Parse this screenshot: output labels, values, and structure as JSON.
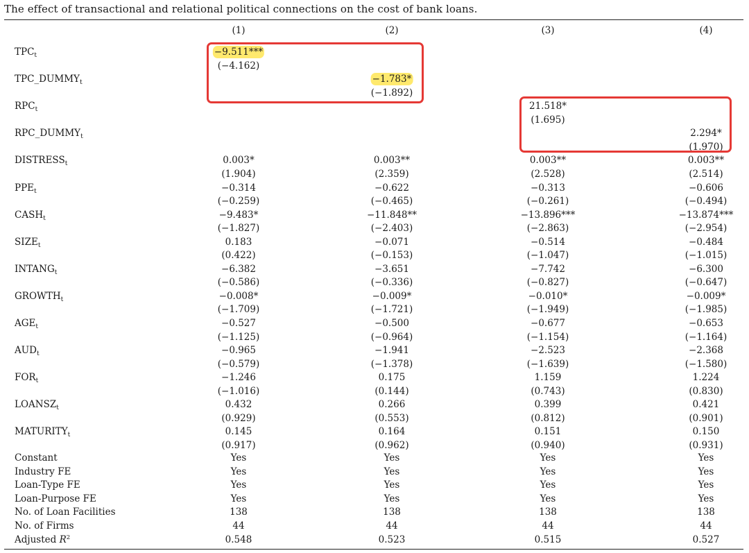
{
  "title": "The effect of transactional and relational political connections on the cost of bank loans.",
  "columns": [
    "(1)",
    "(2)",
    "(3)",
    "(4)"
  ],
  "rows": [
    {
      "name": "TPC",
      "sub": "t",
      "coef": [
        "−9.511***",
        "",
        "",
        ""
      ],
      "t": [
        "(−4.162)",
        "",
        "",
        ""
      ]
    },
    {
      "name": "TPC_DUMMY",
      "sub": "t",
      "coef": [
        "",
        "−1.783*",
        "",
        ""
      ],
      "t": [
        "",
        "(−1.892)",
        "",
        ""
      ]
    },
    {
      "name": "RPC",
      "sub": "t",
      "coef": [
        "",
        "",
        "21.518*",
        ""
      ],
      "t": [
        "",
        "",
        "(1.695)",
        ""
      ]
    },
    {
      "name": "RPC_DUMMY",
      "sub": "t",
      "coef": [
        "",
        "",
        "",
        "2.294*"
      ],
      "t": [
        "",
        "",
        "",
        "(1.970)"
      ]
    },
    {
      "name": "DISTRESS",
      "sub": "t",
      "coef": [
        "0.003*",
        "0.003**",
        "0.003**",
        "0.003**"
      ],
      "t": [
        "(1.904)",
        "(2.359)",
        "(2.528)",
        "(2.514)"
      ]
    },
    {
      "name": "PPE",
      "sub": "t",
      "coef": [
        "−0.314",
        "−0.622",
        "−0.313",
        "−0.606"
      ],
      "t": [
        "(−0.259)",
        "(−0.465)",
        "(−0.261)",
        "(−0.494)"
      ]
    },
    {
      "name": "CASH",
      "sub": "t",
      "coef": [
        "−9.483*",
        "−11.848**",
        "−13.896***",
        "−13.874***"
      ],
      "t": [
        "(−1.827)",
        "(−2.403)",
        "(−2.863)",
        "(−2.954)"
      ]
    },
    {
      "name": "SIZE",
      "sub": "t",
      "coef": [
        "0.183",
        "−0.071",
        "−0.514",
        "−0.484"
      ],
      "t": [
        "(0.422)",
        "(−0.153)",
        "(−1.047)",
        "(−1.015)"
      ]
    },
    {
      "name": "INTANG",
      "sub": "t",
      "coef": [
        "−6.382",
        "−3.651",
        "−7.742",
        "−6.300"
      ],
      "t": [
        "(−0.586)",
        "(−0.336)",
        "(−0.827)",
        "(−0.647)"
      ]
    },
    {
      "name": "GROWTH",
      "sub": "t",
      "coef": [
        "−0.008*",
        "−0.009*",
        "−0.010*",
        "−0.009*"
      ],
      "t": [
        "(−1.709)",
        "(−1.721)",
        "(−1.949)",
        "(−1.985)"
      ]
    },
    {
      "name": "AGE",
      "sub": "t",
      "coef": [
        "−0.527",
        "−0.500",
        "−0.677",
        "−0.653"
      ],
      "t": [
        "(−1.125)",
        "(−0.964)",
        "(−1.154)",
        "(−1.164)"
      ]
    },
    {
      "name": "AUD",
      "sub": "t",
      "coef": [
        "−0.965",
        "−1.941",
        "−2.523",
        "−2.368"
      ],
      "t": [
        "(−0.579)",
        "(−1.378)",
        "(−1.639)",
        "(−1.580)"
      ]
    },
    {
      "name": "FOR",
      "sub": "t",
      "coef": [
        "−1.246",
        "0.175",
        "1.159",
        "1.224"
      ],
      "t": [
        "(−1.016)",
        "(0.144)",
        "(0.743)",
        "(0.830)"
      ]
    },
    {
      "name": "LOANSZ",
      "sub": "t",
      "coef": [
        "0.432",
        "0.266",
        "0.399",
        "0.421"
      ],
      "t": [
        "(0.929)",
        "(0.553)",
        "(0.812)",
        "(0.901)"
      ]
    },
    {
      "name": "MATURITY",
      "sub": "t",
      "coef": [
        "0.145",
        "0.164",
        "0.151",
        "0.150"
      ],
      "t": [
        "(0.917)",
        "(0.962)",
        "(0.940)",
        "(0.931)"
      ]
    }
  ],
  "footer": [
    {
      "name": "Constant",
      "vals": [
        "Yes",
        "Yes",
        "Yes",
        "Yes"
      ]
    },
    {
      "name": "Industry FE",
      "vals": [
        "Yes",
        "Yes",
        "Yes",
        "Yes"
      ]
    },
    {
      "name": "Loan-Type FE",
      "vals": [
        "Yes",
        "Yes",
        "Yes",
        "Yes"
      ]
    },
    {
      "name": "Loan-Purpose FE",
      "vals": [
        "Yes",
        "Yes",
        "Yes",
        "Yes"
      ]
    },
    {
      "name": "No. of Loan Facilities",
      "vals": [
        "138",
        "138",
        "138",
        "138"
      ]
    },
    {
      "name": "No. of Firms",
      "vals": [
        "44",
        "44",
        "44",
        "44"
      ]
    },
    {
      "name": "Adjusted",
      "italic": "R",
      "sup": "2",
      "vals": [
        "0.548",
        "0.523",
        "0.515",
        "0.527"
      ]
    }
  ],
  "highlights": [
    "−9.511***",
    "−1.783*"
  ],
  "colors": {
    "highlight": "#ffe23c",
    "annotation_box": "#e53935",
    "text": "#1a1a1a"
  }
}
